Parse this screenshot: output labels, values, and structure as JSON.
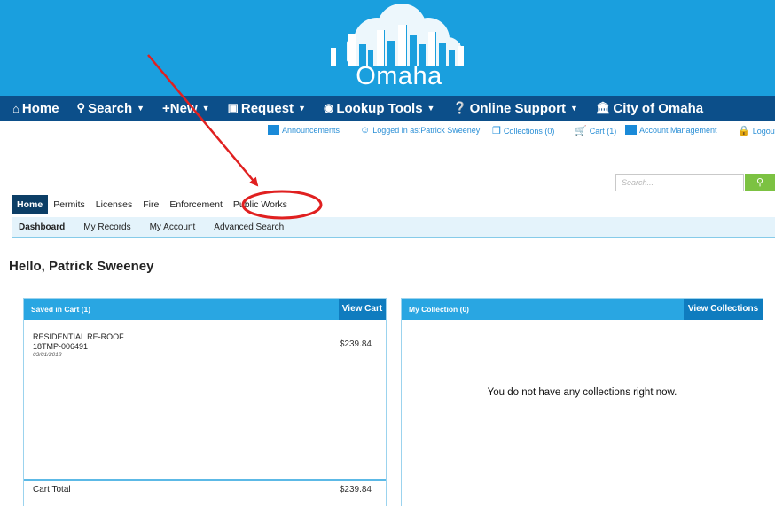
{
  "banner": {
    "city_name": "Omaha"
  },
  "nav": {
    "items": [
      {
        "label": "Home",
        "icon": "home-icon",
        "has_caret": false
      },
      {
        "label": "Search",
        "icon": "search-icon",
        "has_caret": true
      },
      {
        "label": "+New",
        "icon": "",
        "has_caret": true
      },
      {
        "label": "Request",
        "icon": "calendar-icon",
        "has_caret": true
      },
      {
        "label": "Lookup Tools",
        "icon": "eye-icon",
        "has_caret": true
      },
      {
        "label": "Online Support",
        "icon": "help-icon",
        "has_caret": true
      },
      {
        "label": "City of Omaha",
        "icon": "building-icon",
        "has_caret": false
      }
    ]
  },
  "utility": {
    "announcements": "Announcements",
    "logged_in": "Logged in as:Patrick Sweeney",
    "collections": "Collections (0)",
    "cart": "Cart (1)",
    "account_management": "Account Management",
    "logout": "Logout"
  },
  "search": {
    "placeholder": "Search..."
  },
  "tabs": [
    {
      "label": "Home",
      "active": true
    },
    {
      "label": "Permits",
      "active": false
    },
    {
      "label": "Licenses",
      "active": false
    },
    {
      "label": "Fire",
      "active": false
    },
    {
      "label": "Enforcement",
      "active": false
    },
    {
      "label": "Public Works",
      "active": false,
      "highlighted": true
    }
  ],
  "subtabs": [
    {
      "label": "Dashboard",
      "active": true
    },
    {
      "label": "My Records",
      "active": false
    },
    {
      "label": "My Account",
      "active": false
    },
    {
      "label": "Advanced Search",
      "active": false
    }
  ],
  "greeting": "Hello, Patrick Sweeney",
  "cart_panel": {
    "title": "Saved in Cart (1)",
    "button": "View Cart",
    "items": [
      {
        "name": "RESIDENTIAL RE-ROOF",
        "record": "18TMP-006491",
        "date": "03/01/2018",
        "price": "$239.84"
      }
    ],
    "total_label": "Cart Total",
    "total_value": "$239.84"
  },
  "collection_panel": {
    "title": "My Collection (0)",
    "button": "View Collections",
    "empty_message": "You do not have any collections right now."
  },
  "colors": {
    "banner": "#1a9fde",
    "nav": "#0c4f8a",
    "panel_header": "#29a6e2",
    "panel_button": "#0f7cbf",
    "annotation": "#e02020",
    "search_button": "#7cc242"
  }
}
